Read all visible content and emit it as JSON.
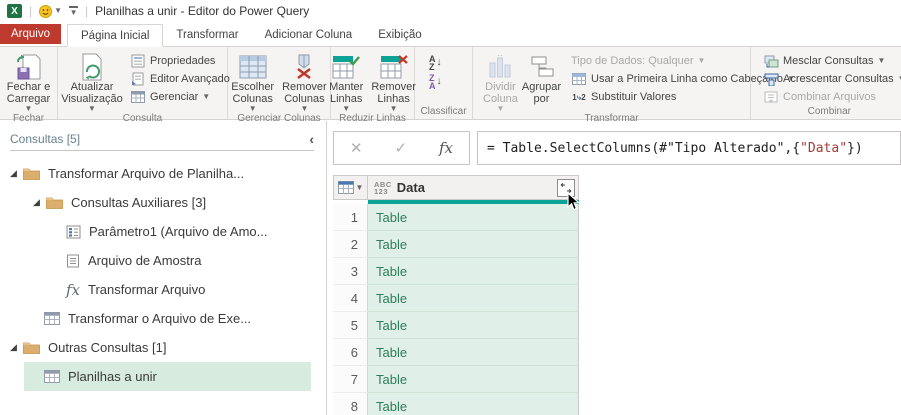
{
  "titlebar": {
    "title": "Planilhas a unir - Editor do Power Query"
  },
  "tabs": {
    "file": "Arquivo",
    "home": "Página Inicial",
    "transform": "Transformar",
    "add_column": "Adicionar Coluna",
    "view": "Exibição"
  },
  "ribbon": {
    "fechar": {
      "group": "Fechar",
      "close_load": "Fechar e Carregar"
    },
    "consulta": {
      "group": "Consulta",
      "refresh": "Atualizar Visualização",
      "properties": "Propriedades",
      "advanced_editor": "Editor Avançado",
      "manage": "Gerenciar"
    },
    "gerenciar_colunas": {
      "group": "Gerenciar Colunas",
      "choose": "Escolher Colunas",
      "remove": "Remover Colunas"
    },
    "reduzir_linhas": {
      "group": "Reduzir Linhas",
      "keep": "Manter Linhas",
      "remove": "Remover Linhas"
    },
    "classificar": {
      "group": "Classificar"
    },
    "transformar": {
      "group": "Transformar",
      "split": "Dividir Coluna",
      "group_by": "Agrupar por",
      "data_type": "Tipo de Dados: Qualquer",
      "first_row": "Usar a Primeira Linha como Cabeçalho",
      "replace": "Substituir Valores"
    },
    "combinar": {
      "group": "Combinar",
      "merge": "Mesclar Consultas",
      "append": "Acrescentar Consultas",
      "combine_files": "Combinar Arquivos"
    }
  },
  "sidebar": {
    "header": "Consultas [5]",
    "items": [
      {
        "label": "Transformar Arquivo de Planilha...",
        "type": "folder"
      },
      {
        "label": "Consultas Auxiliares [3]",
        "type": "folder"
      },
      {
        "label": "Parâmetro1 (Arquivo de Amo...",
        "type": "parameter"
      },
      {
        "label": "Arquivo de Amostra",
        "type": "document"
      },
      {
        "label": "Transformar Arquivo",
        "type": "function"
      },
      {
        "label": "Transformar o Arquivo de Exe...",
        "type": "table"
      },
      {
        "label": "Outras Consultas [1]",
        "type": "folder"
      },
      {
        "label": "Planilhas a unir",
        "type": "table",
        "selected": true
      }
    ]
  },
  "formula": {
    "prefix": "= Table.SelectColumns(#\"Tipo Alterado\",{",
    "string": "\"Data\"",
    "suffix": "})"
  },
  "grid": {
    "column": {
      "type_top": "ABC",
      "type_bottom": "123",
      "name": "Data"
    },
    "rows": [
      {
        "n": "1",
        "value": "Table"
      },
      {
        "n": "2",
        "value": "Table"
      },
      {
        "n": "3",
        "value": "Table"
      },
      {
        "n": "4",
        "value": "Table"
      },
      {
        "n": "5",
        "value": "Table"
      },
      {
        "n": "6",
        "value": "Table"
      },
      {
        "n": "7",
        "value": "Table"
      },
      {
        "n": "8",
        "value": "Table"
      }
    ]
  },
  "colors": {
    "file_tab_red": "#bf3a2e",
    "quality_bar_teal": "#0ba395",
    "selected_item_green": "#d7ecdf",
    "table_link_green": "#2e7d5b",
    "folder_tan": "#dcae6e"
  }
}
